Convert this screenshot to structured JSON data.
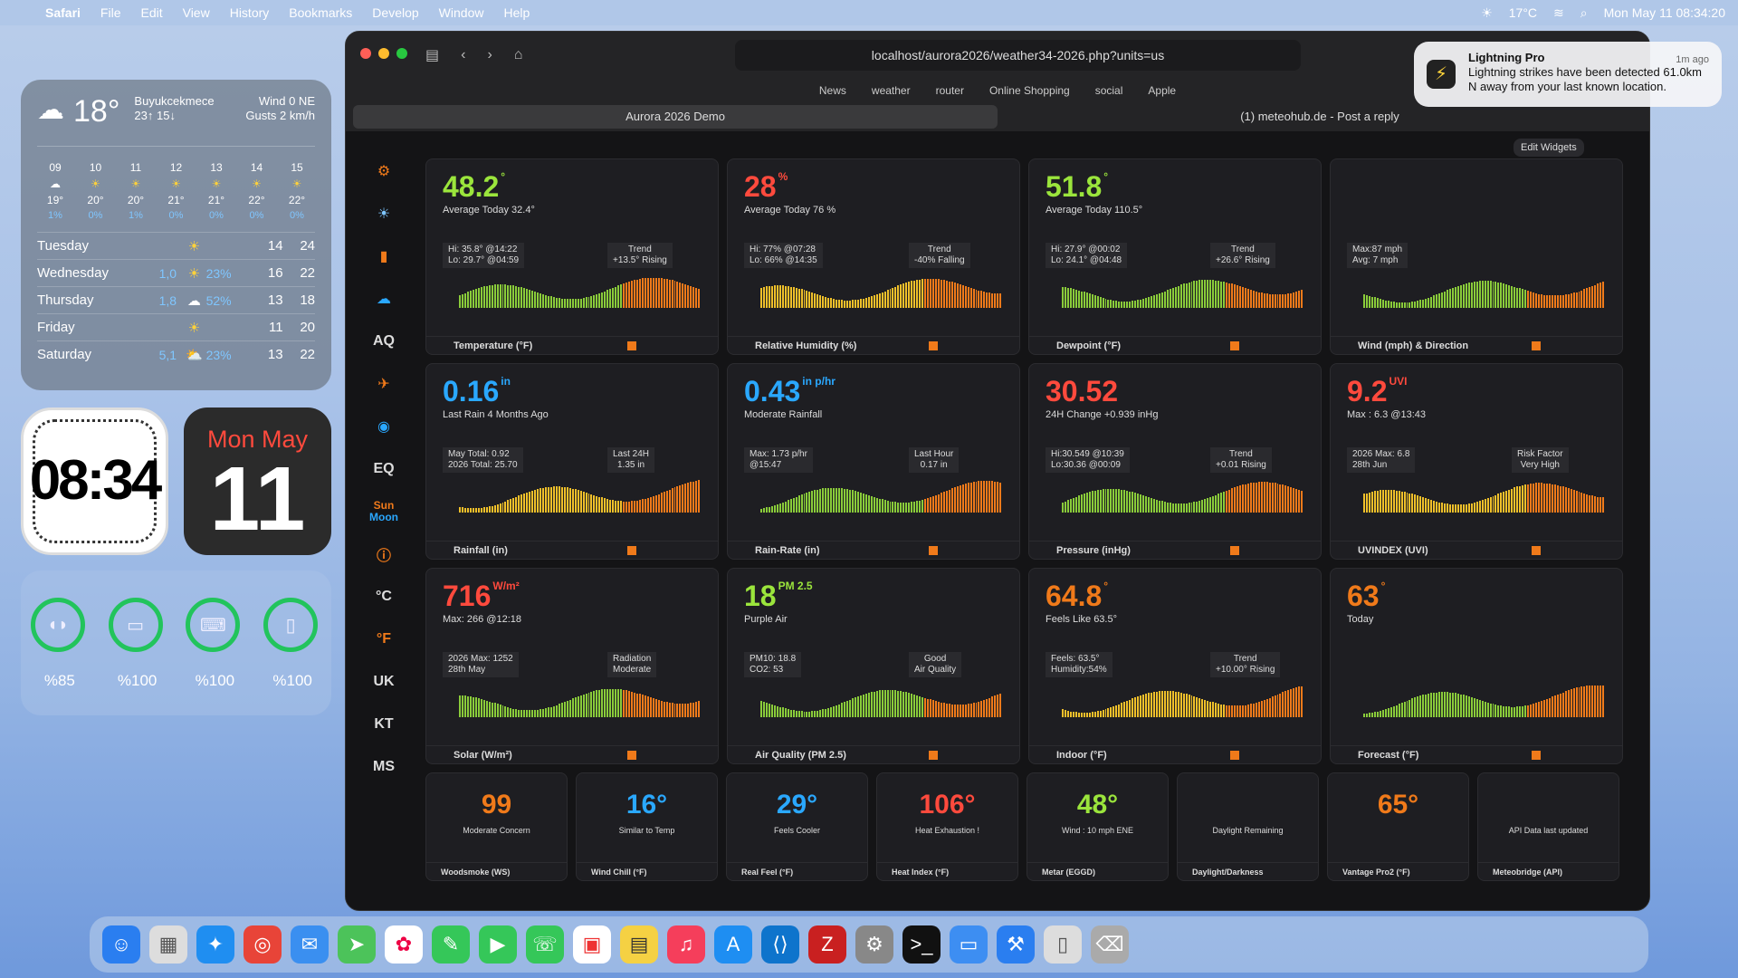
{
  "menubar": {
    "app": "Safari",
    "items": [
      "File",
      "Edit",
      "View",
      "History",
      "Bookmarks",
      "Develop",
      "Window",
      "Help"
    ],
    "weather": "17°C",
    "datetime": "Mon May 11  08:34:20"
  },
  "weather_widget": {
    "temp": "18°",
    "location": "Buyukcekmece",
    "hilo": "23↑ 15↓",
    "wind": "Wind 0 NE",
    "gusts": "Gusts 2 km/h",
    "hours": [
      {
        "h": "09",
        "t": "19°",
        "p": "1%"
      },
      {
        "h": "10",
        "t": "20°",
        "p": "0%"
      },
      {
        "h": "11",
        "t": "20°",
        "p": "1%"
      },
      {
        "h": "12",
        "t": "21°",
        "p": "0%"
      },
      {
        "h": "13",
        "t": "21°",
        "p": "0%"
      },
      {
        "h": "14",
        "t": "22°",
        "p": "0%"
      },
      {
        "h": "15",
        "t": "22°",
        "p": "0%"
      }
    ],
    "days": [
      {
        "n": "Tuesday",
        "pp": "",
        "pc": "",
        "lo": "14",
        "hi": "24"
      },
      {
        "n": "Wednesday",
        "pp": "1,0",
        "pc": "23%",
        "lo": "16",
        "hi": "22"
      },
      {
        "n": "Thursday",
        "pp": "1,8",
        "pc": "52%",
        "lo": "13",
        "hi": "18"
      },
      {
        "n": "Friday",
        "pp": "",
        "pc": "",
        "lo": "11",
        "hi": "20"
      },
      {
        "n": "Saturday",
        "pp": "5,1",
        "pc": "23%",
        "lo": "13",
        "hi": "22"
      }
    ]
  },
  "clock": {
    "time": "08:34"
  },
  "calendar": {
    "month": "Mon May",
    "day": "11"
  },
  "batteries": [
    "%85",
    "%100",
    "%100",
    "%100"
  ],
  "browser": {
    "url": "localhost/aurora2026/weather34-2026.php?units=us",
    "bookmarks": [
      "News",
      "weather",
      "router",
      "Online Shopping",
      "social",
      "Apple"
    ],
    "tab1": "Aurora 2026 Demo",
    "tab2": "(1) meteohub.de - Post a reply",
    "edit": "Edit Widgets"
  },
  "sidebar": [
    "AQ",
    "EQ",
    "Sun",
    "Moon",
    "°C",
    "°F",
    "UK",
    "KT",
    "MS"
  ],
  "cards": [
    {
      "v": "48.2",
      "u": "°",
      "sub": "Average Today 32.4°",
      "i1": "Hi: 35.8° @14:22",
      "i2": "Lo: 29.7° @04:59",
      "t1": "Trend",
      "t2": "+13.5° Rising",
      "lab": "Temperature (°F)",
      "c": "#9be53c"
    },
    {
      "v": "28",
      "u": "%",
      "sub": "Average Today 76 %",
      "i1": "Hi: 77% @07:28",
      "i2": "Lo: 66% @14:35",
      "t1": "Trend",
      "t2": "-40% Falling",
      "lab": "Relative Humidity (%)",
      "c": "#ff4a3d"
    },
    {
      "v": "51.8",
      "u": "°",
      "sub": "Average Today 110.5°",
      "i1": "Hi: 27.9° @00:02",
      "i2": "Lo: 24.1° @04:48",
      "t1": "Trend",
      "t2": "+26.6° Rising",
      "lab": "Dewpoint (°F)",
      "c": "#9be53c"
    },
    {
      "v": "",
      "u": "",
      "sub": "",
      "i1": "Max:87 mph",
      "i2": "Avg: 7 mph",
      "t1": "",
      "t2": "",
      "lab": "Wind (mph) & Direction",
      "c": "#fff"
    },
    {
      "v": "0.16",
      "u": "in",
      "sub": "Last Rain 4 Months Ago",
      "i1": "May Total: 0.92",
      "i2": "2026 Total: 25.70",
      "t1": "Last 24H",
      "t2": "1.35 in",
      "lab": "Rainfall (in)",
      "c": "#2aa8ff"
    },
    {
      "v": "0.43",
      "u": "in p/hr",
      "sub": "Moderate Rainfall",
      "i1": "Max: 1.73 p/hr",
      "i2": "@15:47",
      "t1": "Last Hour",
      "t2": "0.17 in",
      "lab": "Rain-Rate (in)",
      "c": "#2aa8ff"
    },
    {
      "v": "30.52",
      "u": "",
      "sub": "24H Change +0.939 inHg",
      "i1": "Hi:30.549 @10:39",
      "i2": "Lo:30.36 @00:09",
      "t1": "Trend",
      "t2": "+0.01 Rising",
      "lab": "Pressure (inHg)",
      "c": "#ff4a3d"
    },
    {
      "v": "9.2",
      "u": "UVI",
      "sub": "Max : 6.3 @13:43",
      "i1": "2026 Max: 6.8",
      "i2": "28th Jun",
      "t1": "Risk Factor",
      "t2": "Very High",
      "lab": "UVINDEX (UVI)",
      "c": "#ff4a3d"
    },
    {
      "v": "716",
      "u": "W/m²",
      "sub": "Max: 266 @12:18",
      "i1": "2026 Max: 1252",
      "i2": "28th May",
      "t1": "Radiation",
      "t2": "Moderate",
      "lab": "Solar (W/m²)",
      "c": "#ff4a3d"
    },
    {
      "v": "18",
      "u": "PM 2.5",
      "sub": "Purple Air",
      "i1": "PM10: 18.8",
      "i2": "CO2: 53",
      "t1": "Good",
      "t2": "Air Quality",
      "lab": "Air Quality (PM 2.5)",
      "c": "#9be53c"
    },
    {
      "v": "64.8",
      "u": "°",
      "sub": "Feels Like 63.5°",
      "i1": "Feels: 63.5°",
      "i2": "Humidity:54%",
      "t1": "Trend",
      "t2": "+10.00° Rising",
      "lab": "Indoor (°F)",
      "c": "#f07a1a"
    },
    {
      "v": "63",
      "u": "°",
      "sub": "Today",
      "i1": "",
      "i2": "",
      "t1": "",
      "t2": "",
      "lab": "Forecast (°F)",
      "c": "#f07a1a"
    }
  ],
  "small": [
    {
      "v": "99",
      "sub": "Moderate Concern",
      "lab": "Woodsmoke (WS)",
      "c": "#f07a1a"
    },
    {
      "v": "16°",
      "sub": "Similar to Temp",
      "lab": "Wind Chill (°F)",
      "c": "#2aa8ff"
    },
    {
      "v": "29°",
      "sub": "Feels Cooler",
      "lab": "Real Feel (°F)",
      "c": "#2aa8ff"
    },
    {
      "v": "106°",
      "sub": "Heat Exhaustion !",
      "lab": "Heat Index (°F)",
      "c": "#ff4a3d"
    },
    {
      "v": "48°",
      "sub": "Wind : 10 mph ENE",
      "lab": "Metar (EGGD)",
      "c": "#9be53c"
    },
    {
      "v": "",
      "sub": "Daylight Remaining",
      "lab": "Daylight/Darkness",
      "c": "#fff"
    },
    {
      "v": "65°",
      "sub": "",
      "lab": "Vantage Pro2 (°F)",
      "c": "#f07a1a"
    },
    {
      "v": "",
      "sub": "API Data last updated",
      "lab": "Meteobridge (API)",
      "c": "#fff"
    }
  ],
  "notification": {
    "title": "Lightning Pro",
    "time": "1m ago",
    "body": "Lightning strikes have been detected 61.0km N away from your last known location."
  }
}
